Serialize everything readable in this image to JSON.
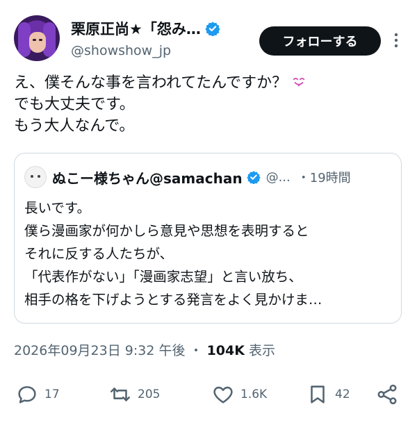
{
  "author": {
    "display_name": "栗原正尚★「怨み…",
    "handle": "@showshow_jp",
    "verified": true
  },
  "follow_button": {
    "label": "フォローする"
  },
  "tweet": {
    "lines": [
      "え、僕そんな事を言われてたんですか？",
      "でも大丈夫です。",
      "もう大人なんで。"
    ],
    "emoji": "tongue-out-smiling-face"
  },
  "quoted_tweet": {
    "display_name": "ぬこー様ちゃん@samachan",
    "handle": "@...",
    "time": "・19時間",
    "verified": true,
    "lines": [
      "長いです。",
      "僕ら漫画家が何かしら意見や思想を表明すると",
      "それに反する人たちが、",
      "「代表作がない」「漫画家志望」と言い放ち、",
      "相手の格を下げようとする発言をよく見かけま…"
    ]
  },
  "meta": {
    "timestamp": "2026年09月23日 9:32 午後",
    "separator": "・",
    "views": "104K",
    "views_label": "表示"
  },
  "actions": {
    "replies": "17",
    "retweets": "205",
    "likes": "1.6K",
    "bookmarks": "42"
  },
  "colors": {
    "verified": "#1d9bf0",
    "follow_bg": "#0f1419",
    "muted": "#536471",
    "border": "#cfd9de"
  }
}
